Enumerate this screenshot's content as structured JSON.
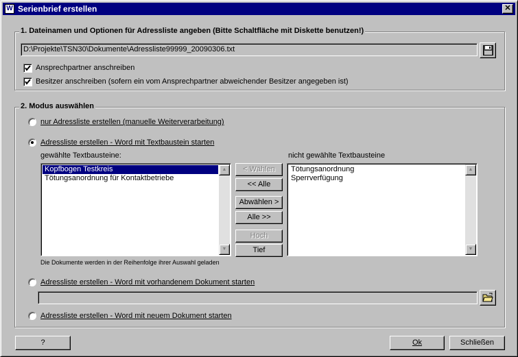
{
  "window": {
    "title": "Serienbrief erstellen",
    "close_glyph": "✕"
  },
  "group1": {
    "legend": "1. Dateinamen und Optionen für Adressliste angeben (Bitte Schaltfläche mit Diskette benutzen!)",
    "file_path": "D:\\Projekte\\TSN30\\Dokumente\\Adressliste99999_20090306.txt",
    "cb1": {
      "label": "Ansprechpartner anschreiben",
      "checked": true
    },
    "cb2": {
      "label": "Besitzer anschreiben (sofern ein vom Ansprechpartner abweichender Besitzer angegeben ist)",
      "checked": true
    }
  },
  "group2": {
    "legend": "2. Modus auswählen",
    "radio1": "nur Adressliste erstellen (manuelle Weiterverarbeitung)",
    "radio2": "Adressliste erstellen  -  Word mit Textbaustein starten",
    "radio3": "Adressliste erstellen  -  Word mit vorhandenem Dokument starten",
    "radio4": "Adressliste erstellen  -  Word mit neuem Dokument starten",
    "selected_mode": 2,
    "selected_label": "gewählte Textbausteine:",
    "selected_items": [
      "Kopfbogen Testkreis",
      "Tötungsanordnung für Kontaktbetriebe"
    ],
    "unselected_label": "nicht gewählte Textbausteine",
    "unselected_items": [
      "Tötungsanordnung",
      "Sperrverfügung"
    ],
    "buttons": {
      "waehlen": "< Wählen",
      "alle_left": "<< Alle",
      "abwaehlen": "Abwählen >",
      "alle_right": "Alle >>",
      "hoch": "Hoch",
      "tief": "Tief"
    },
    "hint": "Die Dokumente werden in der Reihenfolge ihrer Auswahl geladen",
    "doc_path": ""
  },
  "footer": {
    "help": "?",
    "ok": "Ok",
    "close": "Schließen"
  }
}
